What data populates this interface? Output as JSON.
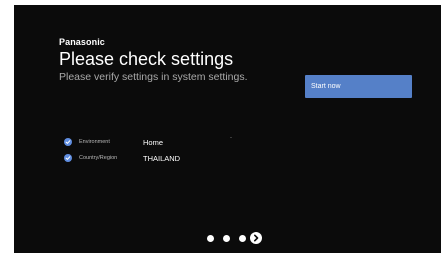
{
  "header": {
    "brand": "Panasonic",
    "title": "Please check settings",
    "subtitle": "Please verify settings in system settings."
  },
  "actions": {
    "start_label": "Start now"
  },
  "settings": [
    {
      "label": "Environment",
      "value": "Home",
      "icon": "check-circle-icon"
    },
    {
      "label": "Country/Region",
      "value": "THAILAND",
      "icon": "check-circle-icon"
    }
  ],
  "pager": {
    "total_steps": 4,
    "current_step": 4,
    "next_icon": "chevron-right-circle-icon"
  },
  "colors": {
    "background": "#0b0b0b",
    "accent": "#5580c8",
    "check": "#5f8de0",
    "text": "#ffffff",
    "muted_text": "#a9a9a9"
  }
}
